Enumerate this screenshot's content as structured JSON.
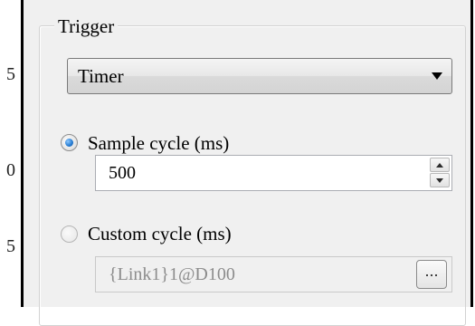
{
  "edge_glyphs": [
    "5",
    "0",
    "5"
  ],
  "trigger": {
    "group_title": "Trigger",
    "mode": {
      "selected": "Timer"
    },
    "sample_cycle": {
      "label": "Sample cycle (ms)",
      "checked": true,
      "value": "500"
    },
    "custom_cycle": {
      "label": "Custom cycle (ms)",
      "checked": false,
      "value": "{Link1}1@D100",
      "browse_label": "..."
    }
  }
}
